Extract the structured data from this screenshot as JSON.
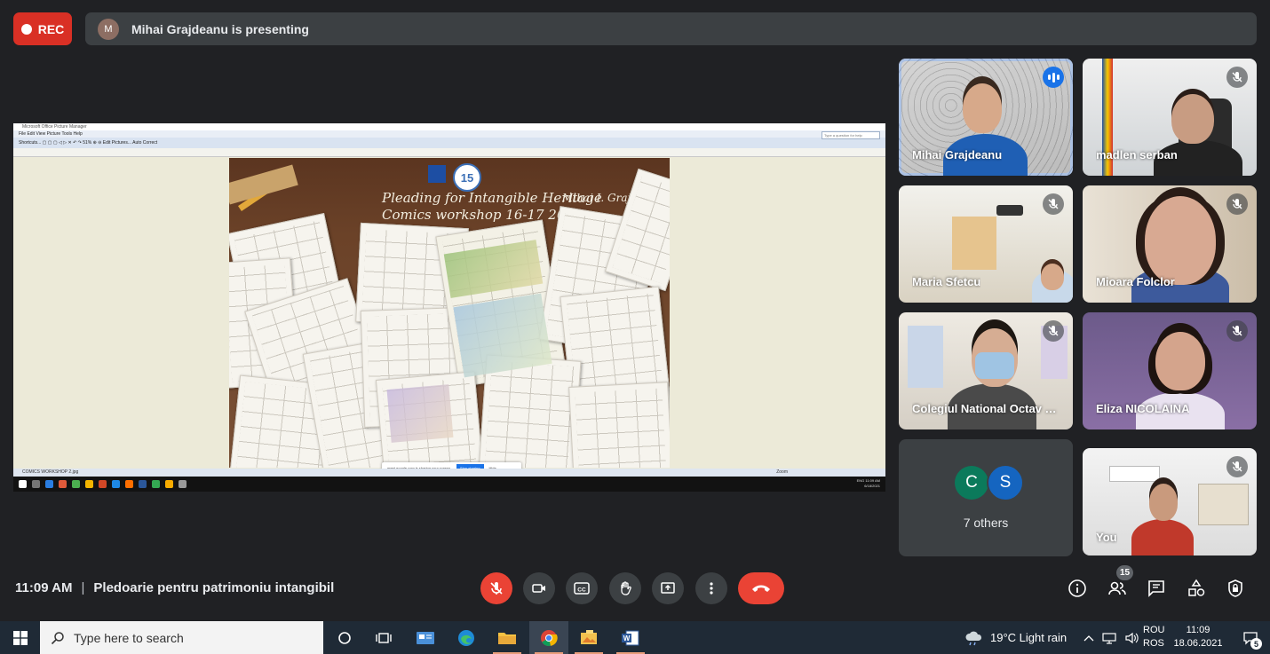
{
  "recording": {
    "label": "REC"
  },
  "presenter_bar": {
    "avatar_initial": "M",
    "text": "Mihai Grajdeanu is presenting"
  },
  "shared_screen": {
    "window_title": "Microsoft Office Picture Manager",
    "menu": "File   Edit   View   Picture   Tools   Help",
    "toolbar": "Shortcuts...    ▢ ▢ ▢   ◁ ▷ ✕   ↶ ↷   51%   ⊕ ⊖   Edit Pictures...   Auto Correct",
    "help_placeholder": "Type a question for help",
    "poster_title_line1": "Pleading for Intangible Heritage",
    "poster_title_line2": "Comics workshop 16-17 2021",
    "poster_signature": "Mihai I. Grajdeanu",
    "status_left": "COMICS WORKSHOP 2.jpg",
    "status_zoom": "Zoom",
    "share_text": "meet.google.com is sharing your screen.",
    "share_stop": "Stop sharing",
    "share_hide": "Hide",
    "clock": "11:09 AM",
    "date": "6/18/2021",
    "lang": "ENG"
  },
  "participants": [
    {
      "name": "Mihai Grajdeanu",
      "state": "speaking"
    },
    {
      "name": "madlen serban",
      "state": "muted"
    },
    {
      "name": "Maria Sfetcu",
      "state": "muted"
    },
    {
      "name": "Mioara Folclor",
      "state": "muted"
    },
    {
      "name": "Colegiul National Octav O...",
      "state": "muted"
    },
    {
      "name": "Eliza NICOLAINA",
      "state": "muted"
    },
    {
      "name": "You",
      "state": "muted"
    }
  ],
  "others_tile": {
    "avatars": [
      "C",
      "S"
    ],
    "label": "7 others"
  },
  "meeting": {
    "time": "11:09 AM",
    "separator": "|",
    "title": "Pledoarie pentru patrimoniu intangibil"
  },
  "people_count": "15",
  "windows": {
    "search_placeholder": "Type here to search",
    "weather": "19°C  Light rain",
    "lang1": "ROU",
    "lang2": "ROS",
    "time": "11:09",
    "date": "18.06.2021",
    "notifications": "5"
  },
  "colors": {
    "accent": "#8ab4f8",
    "end_call": "#ea4335",
    "rec": "#d93025",
    "bg": "#202124"
  }
}
